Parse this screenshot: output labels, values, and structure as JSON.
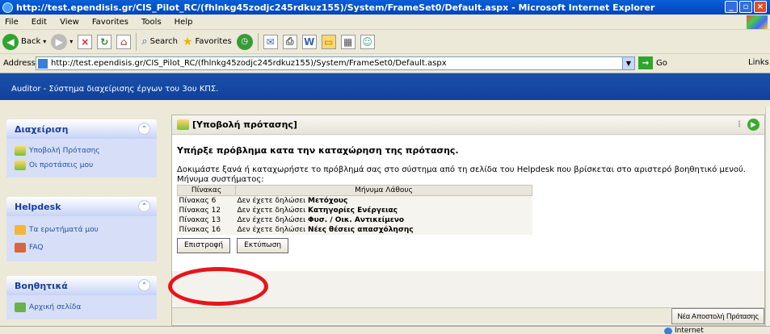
{
  "window": {
    "title": "http://test.ependisis.gr/CIS_Pilot_RC/(fhlnkg45zodjc245rdkuz155)/System/FrameSet0/Default.aspx - Microsoft Internet Explorer",
    "ctrl_min": "_",
    "ctrl_max": "▫",
    "ctrl_close": "×"
  },
  "menu": [
    "File",
    "Edit",
    "View",
    "Favorites",
    "Tools",
    "Help"
  ],
  "toolbar": {
    "back": "Back",
    "search": "Search",
    "favorites": "Favorites"
  },
  "address": {
    "label": "Address",
    "url": "http://test.ependisis.gr/CIS_Pilot_RC/(fhlnkg45zodjc245rdkuz155)/System/FrameSet0/Default.aspx",
    "go": "Go",
    "links": "Links"
  },
  "app": {
    "header": "Auditor - Σύστημα διαχείρισης έργων του 3ου ΚΠΣ."
  },
  "sidebar": {
    "panels": [
      {
        "title": "Διαχείριση",
        "items": [
          "Υποβολή Πρότασης",
          "Οι προτάσεις μου"
        ]
      },
      {
        "title": "Helpdesk",
        "items": [
          "Τα ερωτήματά μου",
          "FAQ"
        ]
      },
      {
        "title": "Βοηθητικά",
        "items": [
          "Αρχική σελίδα"
        ]
      }
    ]
  },
  "main": {
    "title": "[Υποβολή πρότασης]",
    "error_title": "Υπήρξε πρόβλημα κατα την καταχώρηση της πρότασης.",
    "error_message": "Δοκιμάστε ξανά ή καταχωρήστε το πρόβλημά σας στο σύστημα από τη σελίδα του Helpdesk που βρίσκεται στο αριστερό βοηθητικό μενού.",
    "system_message_label": "Μήνυμα συστήματος:",
    "table": {
      "headers": [
        "Πίνακας",
        "Μήνυμα Λάθους"
      ],
      "rows": [
        {
          "table": "Πίνακας 6",
          "prefix": "Δεν έχετε δηλώσει ",
          "item": "Μετόχους"
        },
        {
          "table": "Πίνακας 12",
          "prefix": "Δεν έχετε δηλώσει ",
          "item": "Κατηγορίες Ενέργειας"
        },
        {
          "table": "Πίνακας 13",
          "prefix": "Δεν έχετε δηλώσει ",
          "item": "Φυσ. / Οικ. Αντικείμενο"
        },
        {
          "table": "Πίνακας 16",
          "prefix": "Δεν έχετε δηλώσει ",
          "item": "Νέες θέσεις απασχόλησης"
        }
      ]
    },
    "btn_back": "Επιστροφή",
    "btn_print": "Εκτύπωση",
    "btn_new": "Νέα Αποστολή Πρότασης"
  },
  "status": {
    "zone": "Internet"
  },
  "colors": {
    "header_blue": "#0e3f9a",
    "annotation_red": "#e8141b",
    "panel_title": "#1a3f9a"
  }
}
